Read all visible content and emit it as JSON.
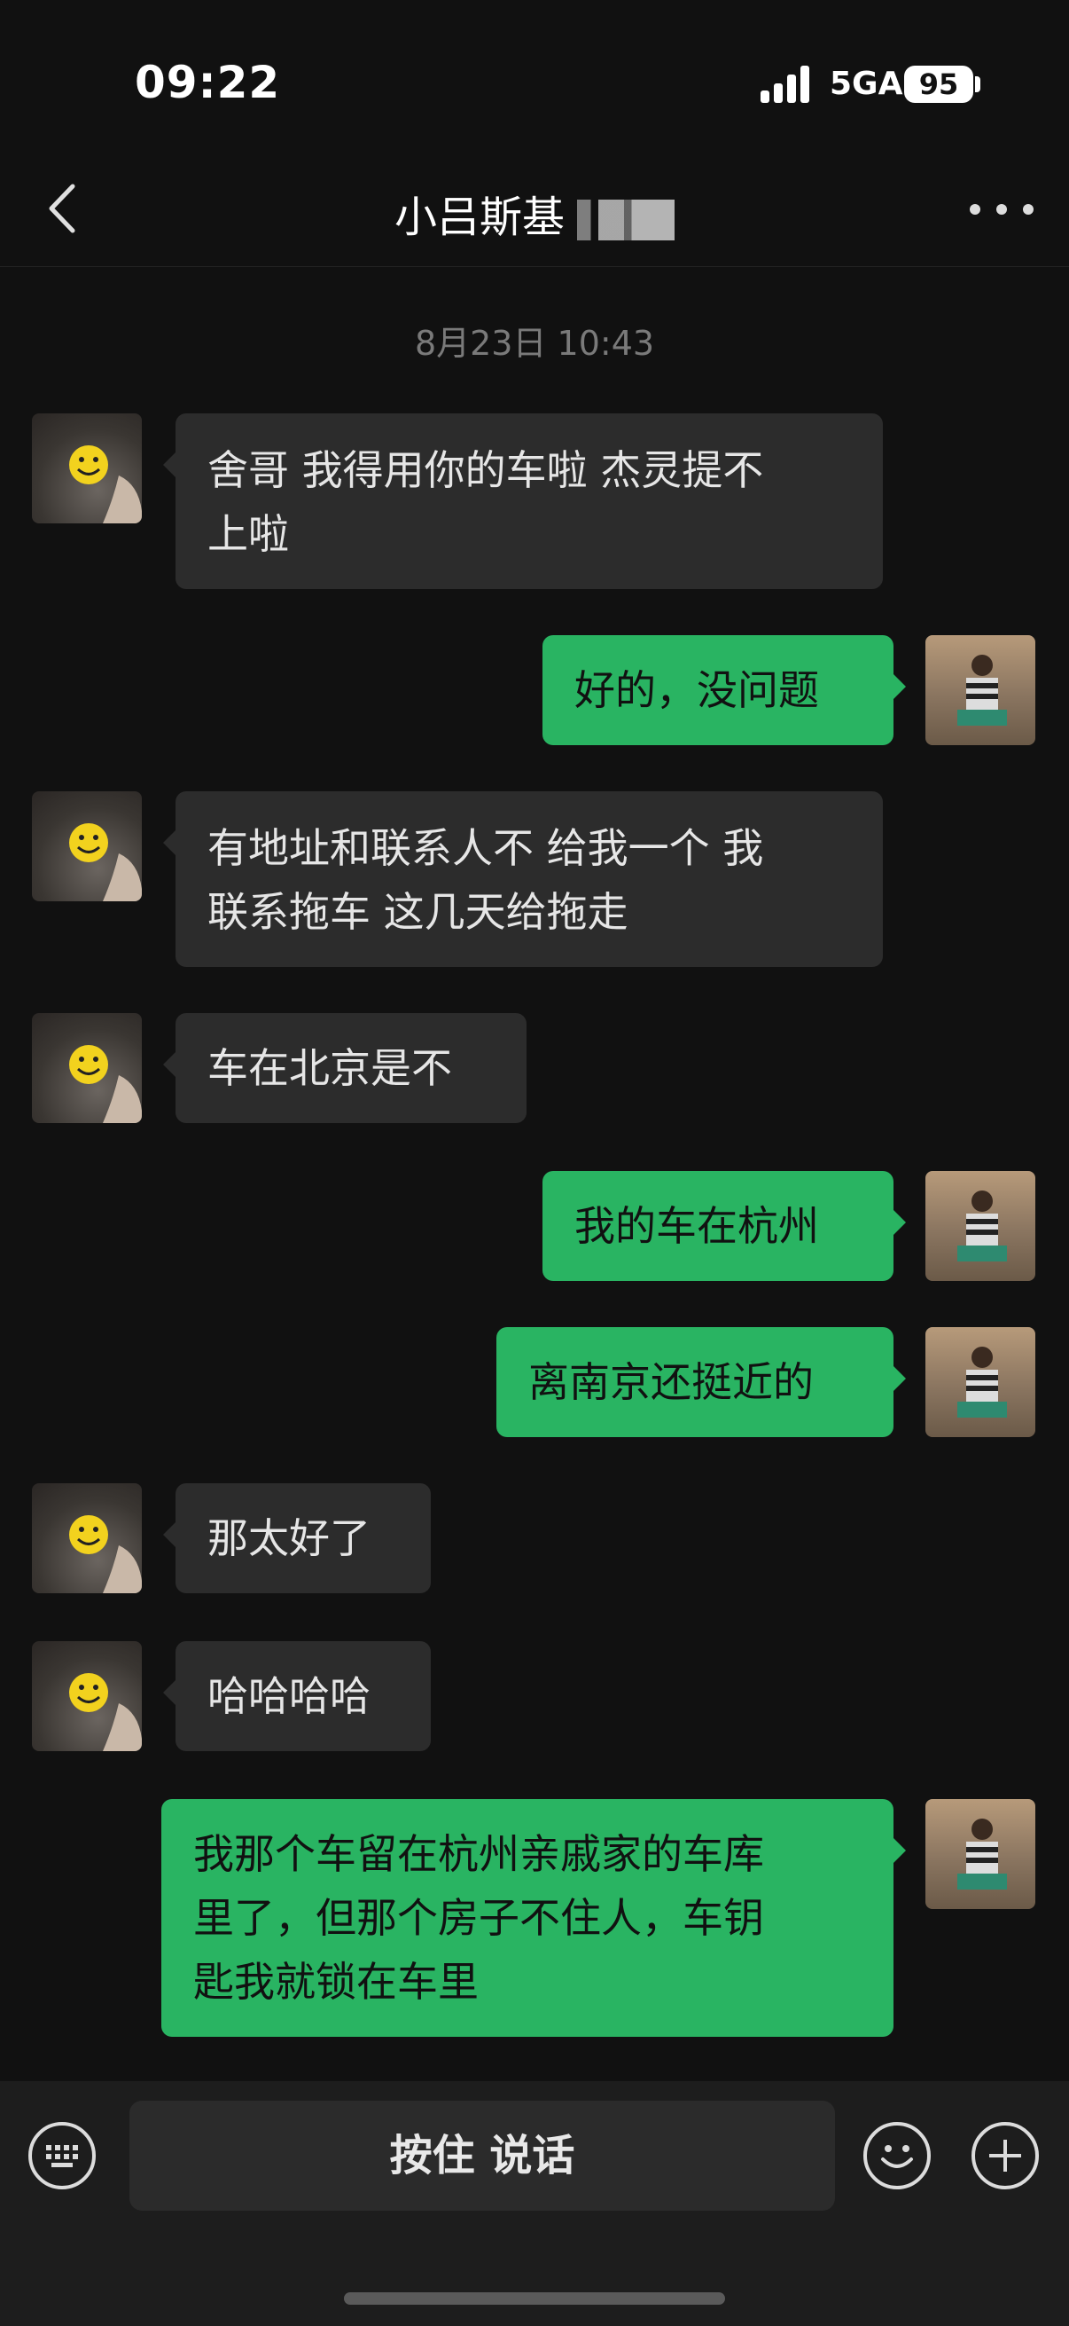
{
  "status_bar": {
    "time": "09:22",
    "network": "5GA",
    "battery": "95"
  },
  "header": {
    "title": "小吕斯基"
  },
  "chat": {
    "timestamp": "8月23日 10:43",
    "messages": [
      {
        "side": "left",
        "lines": [
          "舍哥 我得用你的车啦 杰灵提不",
          "上啦"
        ]
      },
      {
        "side": "right",
        "lines": [
          "好的，没问题"
        ]
      },
      {
        "side": "left",
        "lines": [
          "有地址和联系人不 给我一个 我",
          "联系拖车 这几天给拖走"
        ]
      },
      {
        "side": "left",
        "lines": [
          "车在北京是不"
        ]
      },
      {
        "side": "right",
        "lines": [
          "我的车在杭州"
        ]
      },
      {
        "side": "right",
        "lines": [
          "离南京还挺近的"
        ]
      },
      {
        "side": "left",
        "lines": [
          "那太好了"
        ]
      },
      {
        "side": "left",
        "lines": [
          "哈哈哈哈"
        ]
      },
      {
        "side": "right",
        "lines": [
          "我那个车留在杭州亲戚家的车库",
          "里了，但那个房子不住人，车钥",
          "匙我就锁在车里"
        ]
      }
    ]
  },
  "input_bar": {
    "voice_label": "按住 说话"
  },
  "icons": {
    "back": "chevron-left-icon",
    "more": "more-dots-icon",
    "keyboard": "keyboard-icon",
    "emoji": "emoji-icon",
    "plus": "plus-icon"
  },
  "colors": {
    "background": "#111111",
    "bubble_left": "#2c2c2c",
    "bubble_right": "#29b462"
  }
}
